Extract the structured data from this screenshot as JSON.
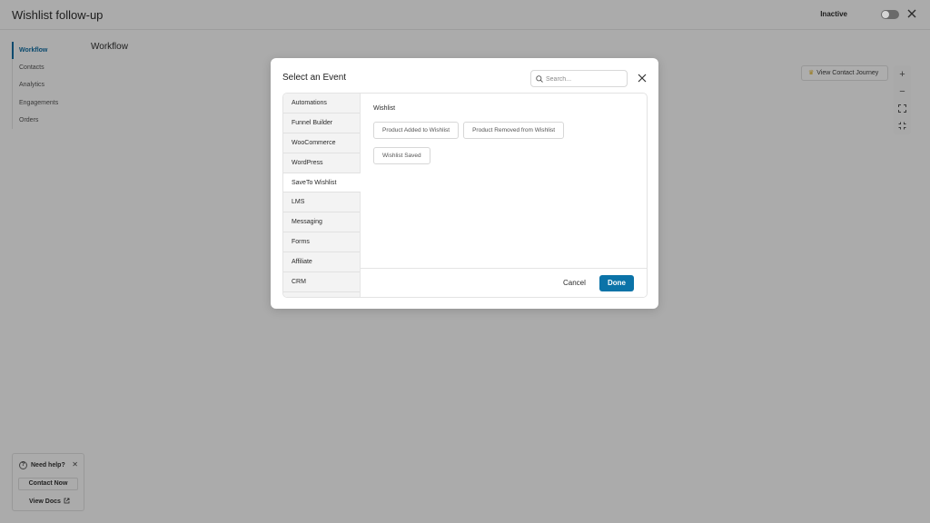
{
  "app": {
    "title": "Wishlist follow-up",
    "status": "Inactive"
  },
  "sidebar": {
    "items": [
      {
        "label": "Workflow"
      },
      {
        "label": "Contacts"
      },
      {
        "label": "Analytics"
      },
      {
        "label": "Engagements"
      },
      {
        "label": "Orders"
      }
    ]
  },
  "main": {
    "heading": "Workflow",
    "journey_button": "View Contact Journey",
    "zoom": {
      "zoom_in": "+",
      "zoom_out": "−"
    }
  },
  "help": {
    "title": "Need help?",
    "contact_button": "Contact Now",
    "docs_link": "View Docs"
  },
  "modal": {
    "title": "Select an Event",
    "search_placeholder": "Search...",
    "categories": [
      {
        "label": "Automations"
      },
      {
        "label": "Funnel Builder"
      },
      {
        "label": "WooCommerce"
      },
      {
        "label": "WordPress"
      },
      {
        "label": "SaveTo Wishlist"
      },
      {
        "label": "LMS"
      },
      {
        "label": "Messaging"
      },
      {
        "label": "Forms"
      },
      {
        "label": "Affiliate"
      },
      {
        "label": "CRM"
      }
    ],
    "selected_category": "SaveTo Wishlist",
    "group_title": "Wishlist",
    "events": [
      {
        "label": "Product Added to Wishlist"
      },
      {
        "label": "Product Removed from Wishlist"
      },
      {
        "label": "Wishlist Saved"
      }
    ],
    "cancel_label": "Cancel",
    "done_label": "Done"
  },
  "colors": {
    "overlay_background": "#ababab",
    "primary": "#0b73a8",
    "active_nav": "#0b4a6e"
  }
}
